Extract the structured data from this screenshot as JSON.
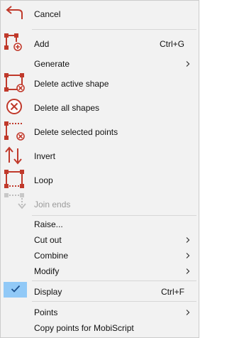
{
  "menu": {
    "cancel": "Cancel",
    "add": "Add",
    "add_shortcut": "Ctrl+G",
    "generate": "Generate",
    "delete_active": "Delete active shape",
    "delete_all": "Delete all shapes",
    "delete_selected": "Delete selected points",
    "invert": "Invert",
    "loop": "Loop",
    "join_ends": "Join ends",
    "raise": "Raise...",
    "cut_out": "Cut out",
    "combine": "Combine",
    "modify": "Modify",
    "display": "Display",
    "display_shortcut": "Ctrl+F",
    "display_checked": true,
    "points": "Points",
    "copy_points": "Copy points for MobiScript"
  },
  "colors": {
    "icon_red": "#c0392b",
    "check_highlight": "#91c9f7",
    "check_mark": "#1a4f8c",
    "disabled_text": "#9a9a9a"
  }
}
